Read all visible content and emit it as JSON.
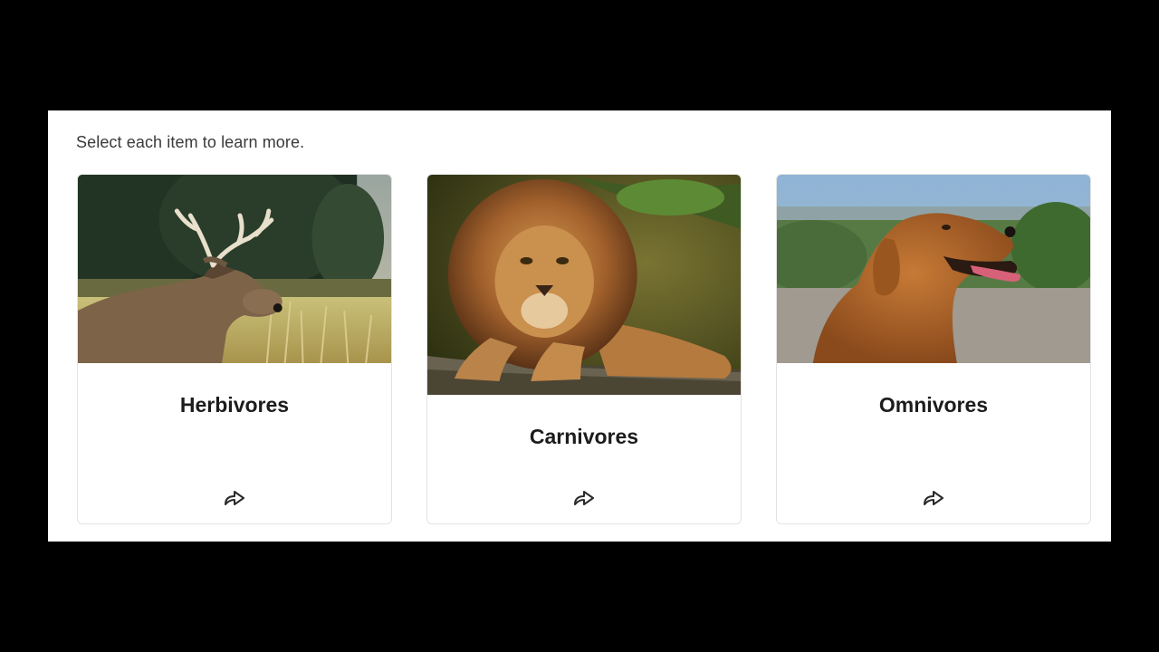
{
  "instructions": "Select each item to learn more.",
  "cards": [
    {
      "title": "Herbivores",
      "image": "deer-photo",
      "icon": "share-arrow-icon"
    },
    {
      "title": "Carnivores",
      "image": "lion-photo",
      "icon": "share-arrow-icon"
    },
    {
      "title": "Omnivores",
      "image": "golden-retriever-photo",
      "icon": "share-arrow-icon"
    }
  ],
  "colors": {
    "background": "#000000",
    "panel": "#ffffff",
    "card_border": "#e3e3e3",
    "title_text": "#1c1c1c",
    "instruction_text": "#3a3a3a"
  }
}
